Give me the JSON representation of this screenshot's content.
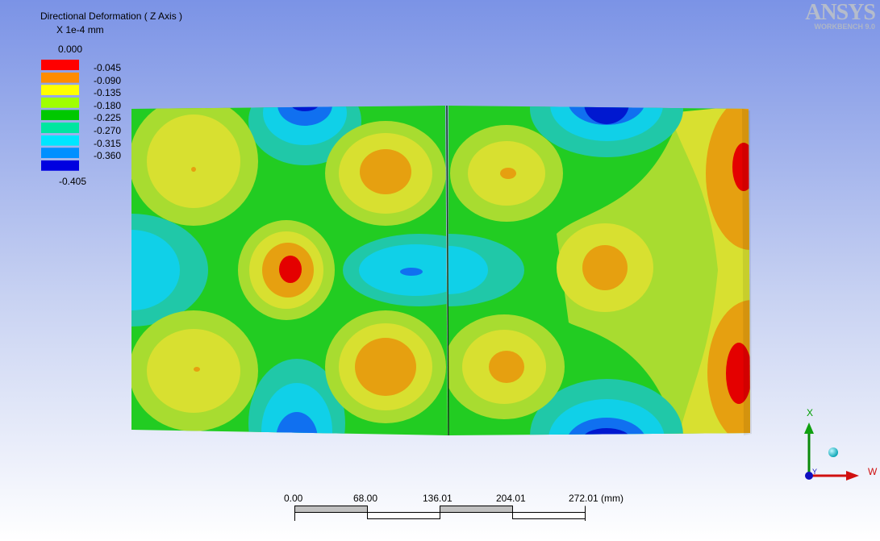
{
  "app": {
    "logo_name": "ANSYS",
    "logo_subtitle": "WORKBENCH 9.0"
  },
  "legend": {
    "title": "Directional Deformation ( Z Axis )",
    "unit": "X 1e-4 mm",
    "max_label": "0.000",
    "min_label": "-0.405",
    "bands": [
      {
        "label": "-0.045",
        "color": "#ff0000"
      },
      {
        "label": "-0.090",
        "color": "#ff8c00"
      },
      {
        "label": "-0.135",
        "color": "#ffff00"
      },
      {
        "label": "-0.180",
        "color": "#a0ff00"
      },
      {
        "label": "-0.225",
        "color": "#00c800"
      },
      {
        "label": "-0.270",
        "color": "#00e6a0"
      },
      {
        "label": "-0.315",
        "color": "#00e6ff"
      },
      {
        "label": "-0.360",
        "color": "#0090ff"
      },
      {
        "label": "",
        "color": "#0000e0"
      }
    ]
  },
  "scale_bar": {
    "ticks": [
      "0.00",
      "68.00",
      "136.01",
      "204.01",
      "272.01 (mm)"
    ]
  },
  "triad": {
    "x_label": "X",
    "w_label": "W",
    "y_label": "Y"
  },
  "colors": {
    "background_top": "#7f96e6",
    "background_bottom": "#ffffff",
    "contour_red": "#e40000",
    "contour_orange": "#e6a010",
    "contour_yellow": "#d8e030",
    "contour_lightgreen": "#a8dc30",
    "contour_green": "#22cc22",
    "contour_teal": "#20c8a8",
    "contour_cyan": "#10d0e8",
    "contour_blue": "#1060f0",
    "contour_darkblue": "#0018d0"
  }
}
